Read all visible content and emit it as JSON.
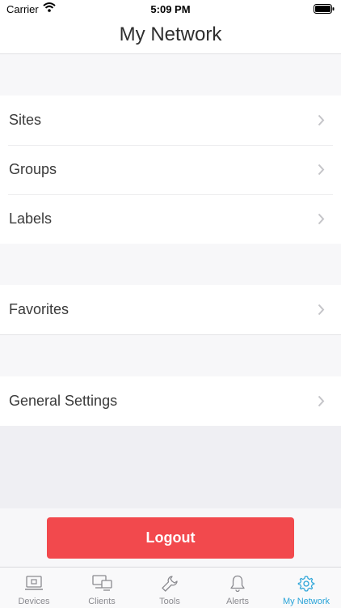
{
  "status_bar": {
    "carrier": "Carrier",
    "time": "5:09 PM"
  },
  "nav": {
    "title": "My Network"
  },
  "menu": {
    "group1": [
      {
        "label": "Sites"
      },
      {
        "label": "Groups"
      },
      {
        "label": "Labels"
      }
    ],
    "group2": [
      {
        "label": "Favorites"
      }
    ],
    "group3": [
      {
        "label": "General Settings"
      }
    ]
  },
  "logout": {
    "label": "Logout",
    "color": "#f2494d"
  },
  "tabs": [
    {
      "label": "Devices",
      "icon": "devices-icon",
      "active": false
    },
    {
      "label": "Clients",
      "icon": "clients-icon",
      "active": false
    },
    {
      "label": "Tools",
      "icon": "wrench-icon",
      "active": false
    },
    {
      "label": "Alerts",
      "icon": "bell-icon",
      "active": false
    },
    {
      "label": "My Network",
      "icon": "gear-icon",
      "active": true
    }
  ],
  "colors": {
    "accent": "#2aa4d8",
    "inactive": "#8a8a8f"
  }
}
